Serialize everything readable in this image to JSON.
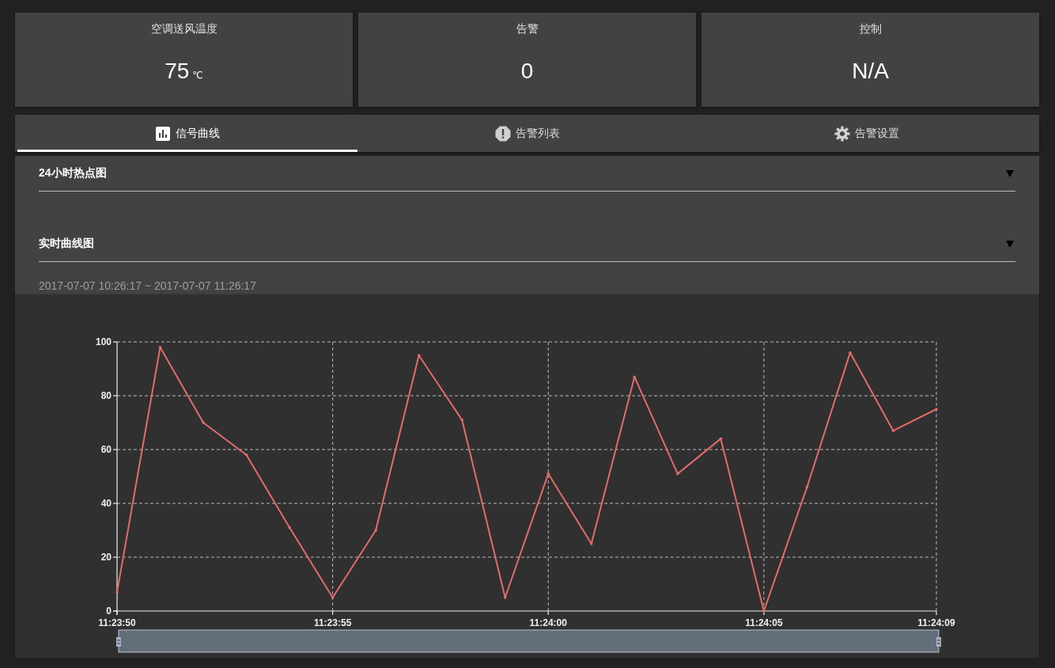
{
  "cards": [
    {
      "title": "空调送风温度",
      "value": "75",
      "unit": "℃"
    },
    {
      "title": "告警",
      "value": "0"
    },
    {
      "title": "控制",
      "value": "N/A"
    }
  ],
  "tabs": [
    {
      "label": "信号曲线",
      "selected": true
    },
    {
      "label": "告警列表",
      "selected": false
    },
    {
      "label": "告警设置",
      "selected": false
    }
  ],
  "sections": [
    {
      "title": "24小时热点图"
    },
    {
      "title": "实时曲线图"
    }
  ],
  "time_range": "2017-07-07 10:26:17 ~ 2017-07-07 11:26:17",
  "chart_data": {
    "type": "line",
    "categories": [
      "11:23:50",
      null,
      null,
      null,
      null,
      "11:23:55",
      null,
      null,
      null,
      null,
      "11:24:00",
      null,
      null,
      null,
      null,
      "11:24:05",
      null,
      null,
      null,
      "11:24:09"
    ],
    "series": [
      {
        "color": "#e06c6c",
        "values": [
          7,
          98,
          70,
          58,
          31,
          5,
          30,
          95,
          71,
          5,
          51,
          25,
          87,
          51,
          64,
          0,
          46,
          96,
          67,
          75
        ]
      }
    ],
    "ylim": [
      0,
      100
    ],
    "grid": true,
    "yticks": [
      0,
      20,
      40,
      60,
      80,
      100
    ]
  }
}
